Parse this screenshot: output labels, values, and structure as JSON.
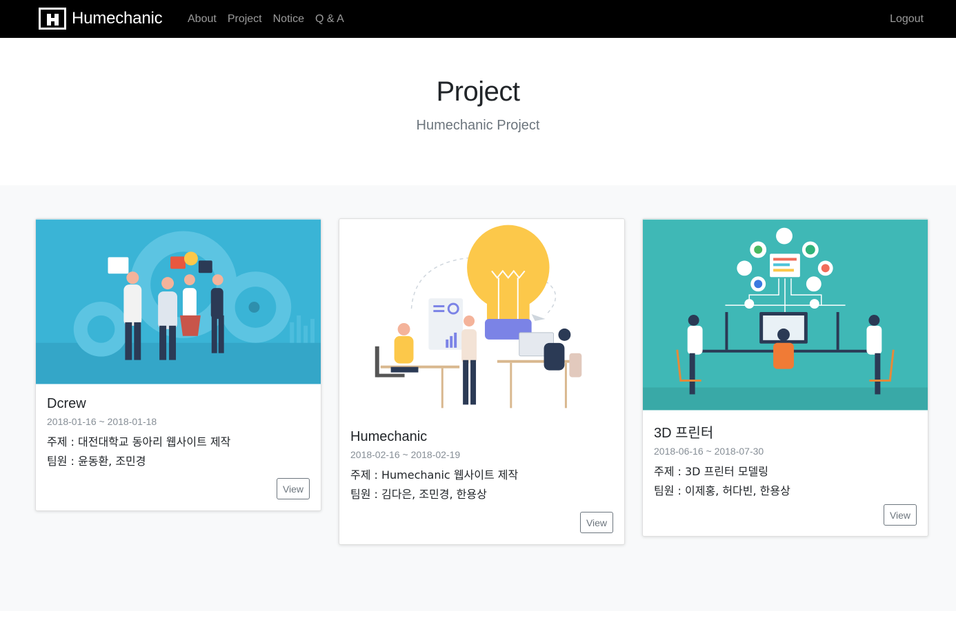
{
  "navbar": {
    "brand": "Humechanic",
    "links": [
      "About",
      "Project",
      "Notice",
      "Q & A"
    ],
    "logout": "Logout"
  },
  "header": {
    "title": "Project",
    "subtitle": "Humechanic Project"
  },
  "cards": [
    {
      "title": "Dcrew",
      "date": "2018-01-16 ~ 2018-01-18",
      "topic": "주제 : 대전대학교 동아리 웹사이트 제작",
      "members": "팀원 : 윤동환, 조민경",
      "button": "View"
    },
    {
      "title": "Humechanic",
      "date": "2018-02-16 ~ 2018-02-19",
      "topic": "주제 : Humechanic 웹사이트 제작",
      "members": "팀원 : 김다은, 조민경, 한용상",
      "button": "View"
    },
    {
      "title": "3D 프린터",
      "date": "2018-06-16 ~ 2018-07-30",
      "topic": "주제 : 3D 프린터 모델링",
      "members": "팀원 : 이제홍, 허다빈, 한용상",
      "button": "View"
    }
  ],
  "colors": {
    "navbar": "#000000",
    "album_bg": "#f8f9fa",
    "card1_image": "#3ab4d6",
    "card3_image": "#3fb8b6",
    "bulb": "#fcc84a"
  }
}
